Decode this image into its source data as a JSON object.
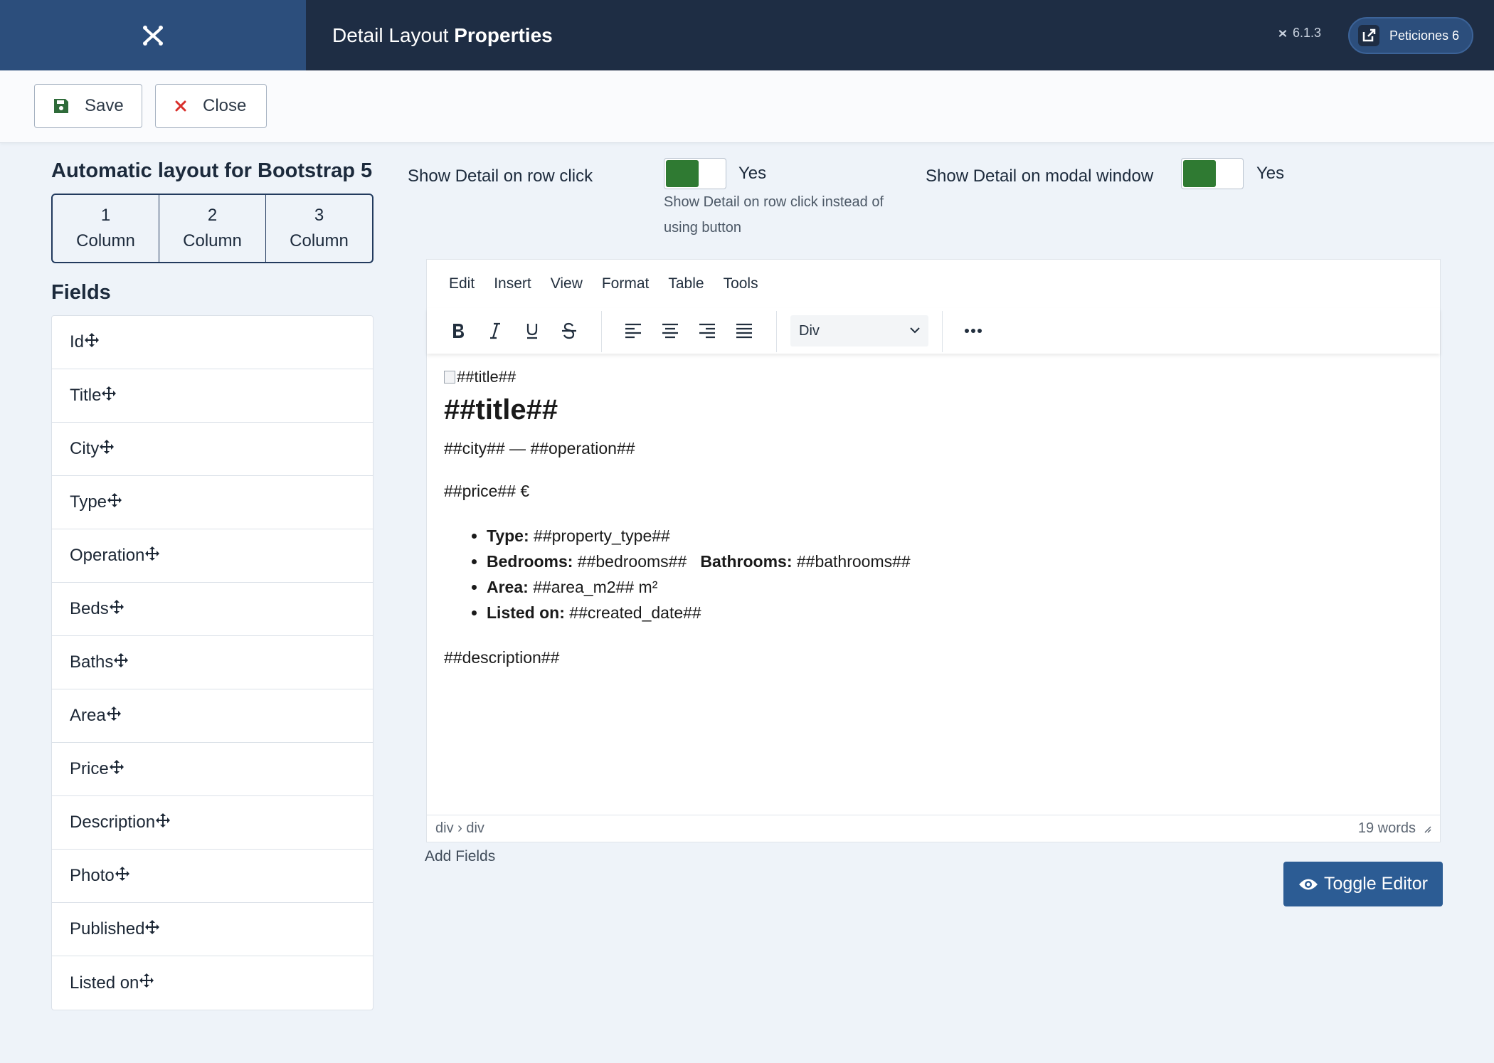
{
  "header": {
    "title_prefix": "Detail Layout ",
    "title_bold": "Properties",
    "version": "6.1.3",
    "peticiones_label": "Peticiones 6"
  },
  "toolbar": {
    "save_label": "Save",
    "close_label": "Close"
  },
  "layout": {
    "title": "Automatic layout for Bootstrap 5",
    "columns": [
      {
        "num": "1",
        "word": "Column"
      },
      {
        "num": "2",
        "word": "Column"
      },
      {
        "num": "3",
        "word": "Column"
      }
    ]
  },
  "fields": {
    "title": "Fields",
    "items": [
      "Id",
      "Title",
      "City",
      "Type",
      "Operation",
      "Beds",
      "Baths",
      "Area",
      "Price",
      "Description",
      "Photo",
      "Published",
      "Listed on"
    ]
  },
  "options": {
    "row_click_label": "Show Detail on row click",
    "row_click_value": "Yes",
    "row_click_help": "Show Detail on row click instead of using button",
    "modal_label": "Show Detail on modal window",
    "modal_value": "Yes"
  },
  "editor": {
    "menus": [
      "Edit",
      "Insert",
      "View",
      "Format",
      "Table",
      "Tools"
    ],
    "block_format": "Div",
    "content": {
      "img_alt": "##title##",
      "heading": "##title##",
      "city_op": "##city## — ##operation##",
      "price": "##price## €",
      "type_label": "Type:",
      "type_value": " ##property_type##",
      "bedrooms_label": "Bedrooms:",
      "bedrooms_value": " ##bedrooms##   ",
      "bathrooms_label": "Bathrooms:",
      "bathrooms_value": " ##bathrooms##",
      "area_label": "Area:",
      "area_value": " ##area_m2## m²",
      "listed_label": "Listed on:",
      "listed_value": " ##created_date##",
      "description": "##description##"
    },
    "path": "div › div",
    "word_count": "19 words"
  },
  "add_fields_label": "Add Fields",
  "toggle_editor_label": "Toggle Editor",
  "colors": {
    "header_bg": "#1e2d44",
    "logo_bg": "#2c4e7c",
    "switch_on": "#2f7a32",
    "toggle_btn": "#2c5c94",
    "close_x": "#d9302c",
    "save_icon": "#2f6b3a"
  }
}
